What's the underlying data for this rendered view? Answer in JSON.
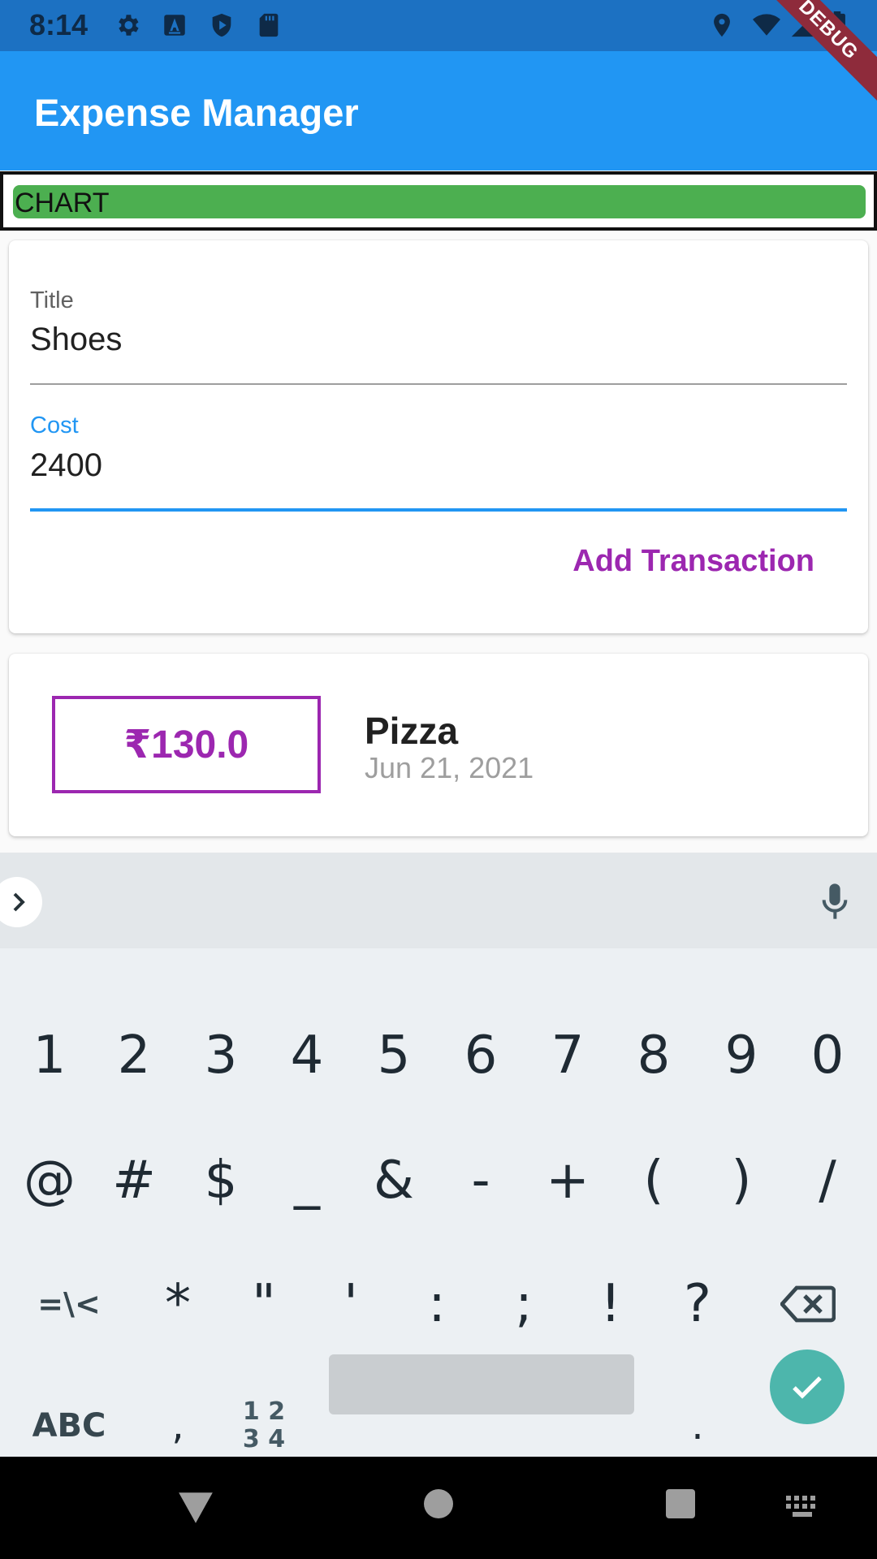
{
  "status_bar": {
    "time": "8:14",
    "left_icons": [
      "settings-icon",
      "text-a-icon",
      "shield-play-icon",
      "sd-card-icon"
    ],
    "right_icons": [
      "location-icon",
      "wifi-icon",
      "signal-icon",
      "battery-icon"
    ]
  },
  "app_bar": {
    "title": "Expense Manager",
    "debug_banner": "DEBUG",
    "color": "#2196f3"
  },
  "chart": {
    "label": "CHART",
    "bar_color": "#4caf50"
  },
  "form": {
    "title_label": "Title",
    "title_value": "Shoes",
    "cost_label": "Cost",
    "cost_value": "2400",
    "submit_label": "Add Transaction",
    "accent_color": "#2196f3",
    "button_color": "#9c27b0"
  },
  "transactions": [
    {
      "amount": "₹130.0",
      "title": "Pizza",
      "date": "Jun 21, 2021"
    }
  ],
  "keyboard": {
    "row1": [
      "1",
      "2",
      "3",
      "4",
      "5",
      "6",
      "7",
      "8",
      "9",
      "0"
    ],
    "row2": [
      "@",
      "#",
      "$",
      "_",
      "&",
      "-",
      "+",
      "(",
      ")",
      "/"
    ],
    "row3": [
      "=\\<",
      "*",
      "\"",
      "'",
      ":",
      ";",
      "!",
      "?"
    ],
    "row4_left": "ABC",
    "row4_comma": ",",
    "row4_numpad_top": "1 2",
    "row4_numpad_bottom": "3 4",
    "row4_period": ".",
    "enter_icon": "check-icon",
    "backspace_icon": "backspace-icon"
  },
  "nav_bar": {
    "icons": [
      "back-icon",
      "home-icon",
      "recents-icon",
      "keyboard-switch-icon"
    ]
  }
}
